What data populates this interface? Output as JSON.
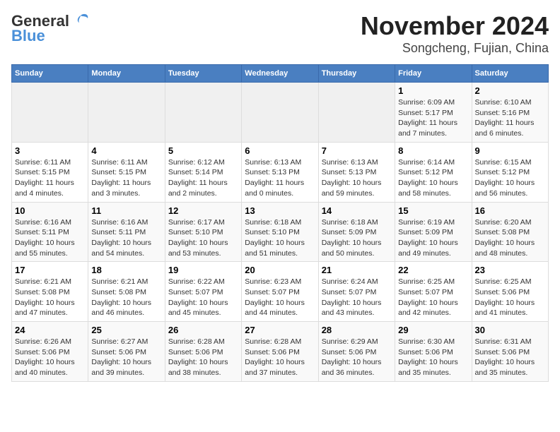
{
  "header": {
    "logo_line1": "General",
    "logo_line2": "Blue",
    "title": "November 2024",
    "subtitle": "Songcheng, Fujian, China"
  },
  "days_of_week": [
    "Sunday",
    "Monday",
    "Tuesday",
    "Wednesday",
    "Thursday",
    "Friday",
    "Saturday"
  ],
  "weeks": [
    [
      {
        "num": "",
        "info": ""
      },
      {
        "num": "",
        "info": ""
      },
      {
        "num": "",
        "info": ""
      },
      {
        "num": "",
        "info": ""
      },
      {
        "num": "",
        "info": ""
      },
      {
        "num": "1",
        "info": "Sunrise: 6:09 AM\nSunset: 5:17 PM\nDaylight: 11 hours and 7 minutes."
      },
      {
        "num": "2",
        "info": "Sunrise: 6:10 AM\nSunset: 5:16 PM\nDaylight: 11 hours and 6 minutes."
      }
    ],
    [
      {
        "num": "3",
        "info": "Sunrise: 6:11 AM\nSunset: 5:15 PM\nDaylight: 11 hours and 4 minutes."
      },
      {
        "num": "4",
        "info": "Sunrise: 6:11 AM\nSunset: 5:15 PM\nDaylight: 11 hours and 3 minutes."
      },
      {
        "num": "5",
        "info": "Sunrise: 6:12 AM\nSunset: 5:14 PM\nDaylight: 11 hours and 2 minutes."
      },
      {
        "num": "6",
        "info": "Sunrise: 6:13 AM\nSunset: 5:13 PM\nDaylight: 11 hours and 0 minutes."
      },
      {
        "num": "7",
        "info": "Sunrise: 6:13 AM\nSunset: 5:13 PM\nDaylight: 10 hours and 59 minutes."
      },
      {
        "num": "8",
        "info": "Sunrise: 6:14 AM\nSunset: 5:12 PM\nDaylight: 10 hours and 58 minutes."
      },
      {
        "num": "9",
        "info": "Sunrise: 6:15 AM\nSunset: 5:12 PM\nDaylight: 10 hours and 56 minutes."
      }
    ],
    [
      {
        "num": "10",
        "info": "Sunrise: 6:16 AM\nSunset: 5:11 PM\nDaylight: 10 hours and 55 minutes."
      },
      {
        "num": "11",
        "info": "Sunrise: 6:16 AM\nSunset: 5:11 PM\nDaylight: 10 hours and 54 minutes."
      },
      {
        "num": "12",
        "info": "Sunrise: 6:17 AM\nSunset: 5:10 PM\nDaylight: 10 hours and 53 minutes."
      },
      {
        "num": "13",
        "info": "Sunrise: 6:18 AM\nSunset: 5:10 PM\nDaylight: 10 hours and 51 minutes."
      },
      {
        "num": "14",
        "info": "Sunrise: 6:18 AM\nSunset: 5:09 PM\nDaylight: 10 hours and 50 minutes."
      },
      {
        "num": "15",
        "info": "Sunrise: 6:19 AM\nSunset: 5:09 PM\nDaylight: 10 hours and 49 minutes."
      },
      {
        "num": "16",
        "info": "Sunrise: 6:20 AM\nSunset: 5:08 PM\nDaylight: 10 hours and 48 minutes."
      }
    ],
    [
      {
        "num": "17",
        "info": "Sunrise: 6:21 AM\nSunset: 5:08 PM\nDaylight: 10 hours and 47 minutes."
      },
      {
        "num": "18",
        "info": "Sunrise: 6:21 AM\nSunset: 5:08 PM\nDaylight: 10 hours and 46 minutes."
      },
      {
        "num": "19",
        "info": "Sunrise: 6:22 AM\nSunset: 5:07 PM\nDaylight: 10 hours and 45 minutes."
      },
      {
        "num": "20",
        "info": "Sunrise: 6:23 AM\nSunset: 5:07 PM\nDaylight: 10 hours and 44 minutes."
      },
      {
        "num": "21",
        "info": "Sunrise: 6:24 AM\nSunset: 5:07 PM\nDaylight: 10 hours and 43 minutes."
      },
      {
        "num": "22",
        "info": "Sunrise: 6:25 AM\nSunset: 5:07 PM\nDaylight: 10 hours and 42 minutes."
      },
      {
        "num": "23",
        "info": "Sunrise: 6:25 AM\nSunset: 5:06 PM\nDaylight: 10 hours and 41 minutes."
      }
    ],
    [
      {
        "num": "24",
        "info": "Sunrise: 6:26 AM\nSunset: 5:06 PM\nDaylight: 10 hours and 40 minutes."
      },
      {
        "num": "25",
        "info": "Sunrise: 6:27 AM\nSunset: 5:06 PM\nDaylight: 10 hours and 39 minutes."
      },
      {
        "num": "26",
        "info": "Sunrise: 6:28 AM\nSunset: 5:06 PM\nDaylight: 10 hours and 38 minutes."
      },
      {
        "num": "27",
        "info": "Sunrise: 6:28 AM\nSunset: 5:06 PM\nDaylight: 10 hours and 37 minutes."
      },
      {
        "num": "28",
        "info": "Sunrise: 6:29 AM\nSunset: 5:06 PM\nDaylight: 10 hours and 36 minutes."
      },
      {
        "num": "29",
        "info": "Sunrise: 6:30 AM\nSunset: 5:06 PM\nDaylight: 10 hours and 35 minutes."
      },
      {
        "num": "30",
        "info": "Sunrise: 6:31 AM\nSunset: 5:06 PM\nDaylight: 10 hours and 35 minutes."
      }
    ]
  ]
}
